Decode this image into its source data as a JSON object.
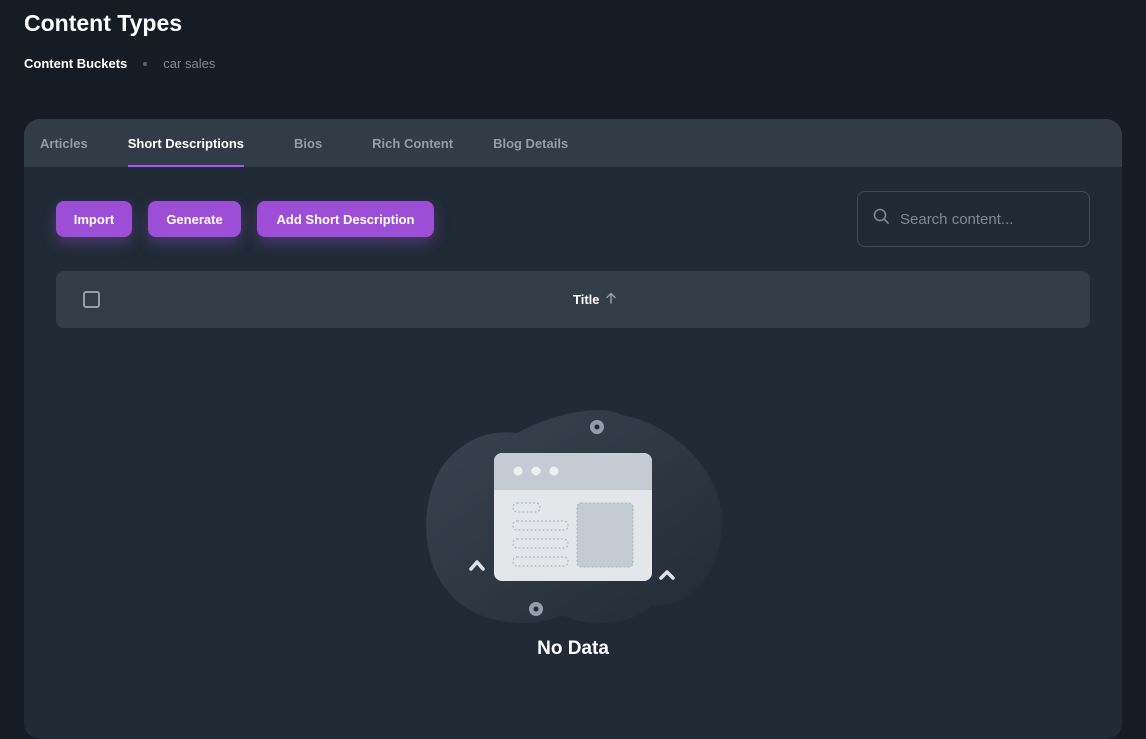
{
  "header": {
    "title": "Content Types",
    "breadcrumb": {
      "current": "Content Buckets",
      "sub": "car sales"
    }
  },
  "tabs": [
    {
      "label": "Articles",
      "active": false
    },
    {
      "label": "Short Descriptions",
      "active": true
    },
    {
      "label": "Bios",
      "active": false
    },
    {
      "label": "Rich Content",
      "active": false
    },
    {
      "label": "Blog Details",
      "active": false
    }
  ],
  "toolbar": {
    "import_label": "Import",
    "generate_label": "Generate",
    "add_label": "Add Short Description"
  },
  "search": {
    "placeholder": "Search content...",
    "value": ""
  },
  "table": {
    "columns": [
      {
        "label": "Title",
        "sort": "ascending"
      }
    ],
    "rows": []
  },
  "empty_state": {
    "label": "No Data"
  },
  "colors": {
    "accent": "#9c4ed6",
    "tab_indicator": "#a855f7",
    "background": "#161c24",
    "card": "#212b36"
  }
}
